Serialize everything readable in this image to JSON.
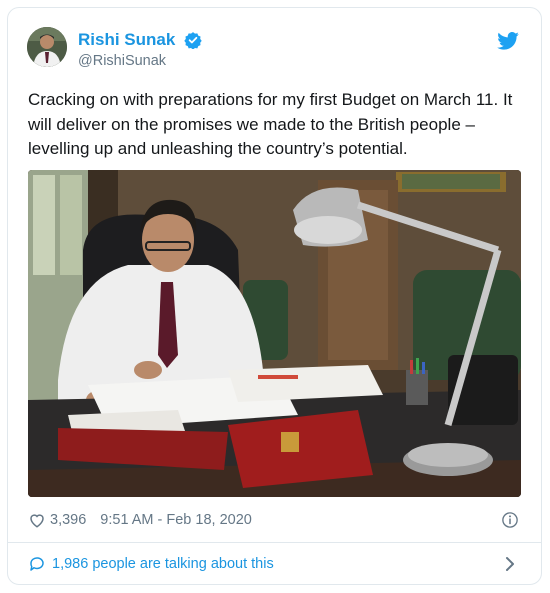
{
  "tweet": {
    "author_name": "Rishi Sunak",
    "handle": "@RishiSunak",
    "text": "Cracking on with preparations for my first Budget on March 11. It will deliver on the promises we made to the British people – levelling up and unleashing the country’s potential.",
    "likes": "3,396",
    "timestamp": "9:51 AM - Feb 18, 2020",
    "talking": "1,986 people are talking about this"
  },
  "icons": {
    "verified": "verified-badge-icon",
    "brand": "twitter-bird-icon",
    "like": "heart-icon",
    "info": "info-icon",
    "reply": "speech-bubble-icon",
    "more": "chevron-right-icon"
  },
  "colors": {
    "accent": "#1b95e0",
    "muted": "#657786",
    "text": "#14171a",
    "border": "#e1e8ed"
  }
}
